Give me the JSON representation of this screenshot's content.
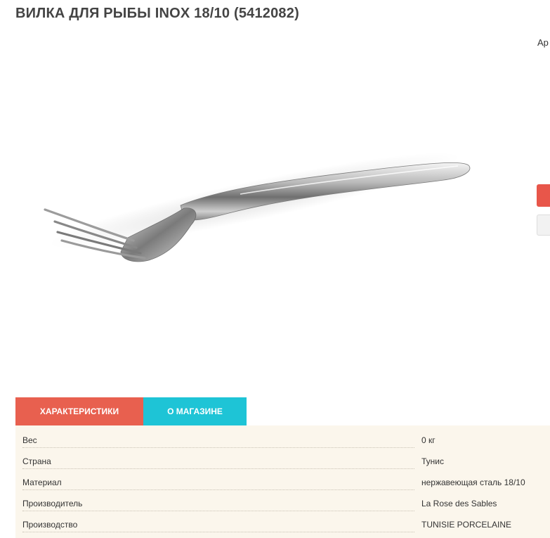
{
  "product": {
    "title": "ВИЛКА ДЛЯ РЫБЫ INOX 18/10 (5412082)",
    "article_label": "Ар"
  },
  "tabs": [
    {
      "label": "ХАРАКТЕРИСТИКИ",
      "active": true,
      "color": "#e8604f"
    },
    {
      "label": "О МАГАЗИНЕ",
      "active": false,
      "color": "#1ec4d6"
    }
  ],
  "specs": [
    {
      "name": "Вес",
      "value": "0 кг"
    },
    {
      "name": "Страна",
      "value": "Тунис"
    },
    {
      "name": "Материал",
      "value": "нержавеющая сталь 18/10"
    },
    {
      "name": "Производитель",
      "value": "La Rose des Sables"
    },
    {
      "name": "Производство",
      "value": "TUNISIE PORCELAINE"
    }
  ],
  "colors": {
    "accent_red": "#e8604f",
    "accent_cyan": "#1ec4d6",
    "specs_bg": "#fbf6ec"
  }
}
